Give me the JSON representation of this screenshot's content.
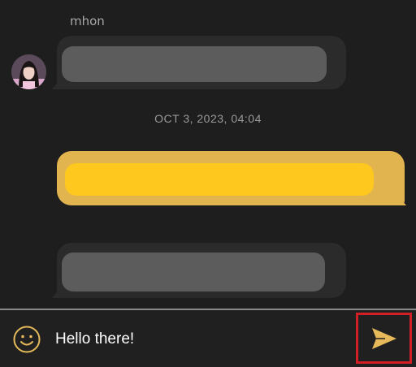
{
  "conversation": {
    "sender_name": "mhon",
    "timestamp": "OCT 3, 2023, 04:04"
  },
  "composer": {
    "input_value": "Hello there!",
    "emoji_icon": "smiley-face-icon",
    "send_icon": "send-arrow-icon"
  },
  "colors": {
    "background": "#1e1e1e",
    "incoming_bubble": "#2b2b2b",
    "incoming_content_redacted": "#5c5c5c",
    "outgoing_bubble": "#e2b450",
    "outgoing_content_redacted": "#ffc81e",
    "accent": "#e6b95a",
    "highlight_box": "#d21f26"
  }
}
